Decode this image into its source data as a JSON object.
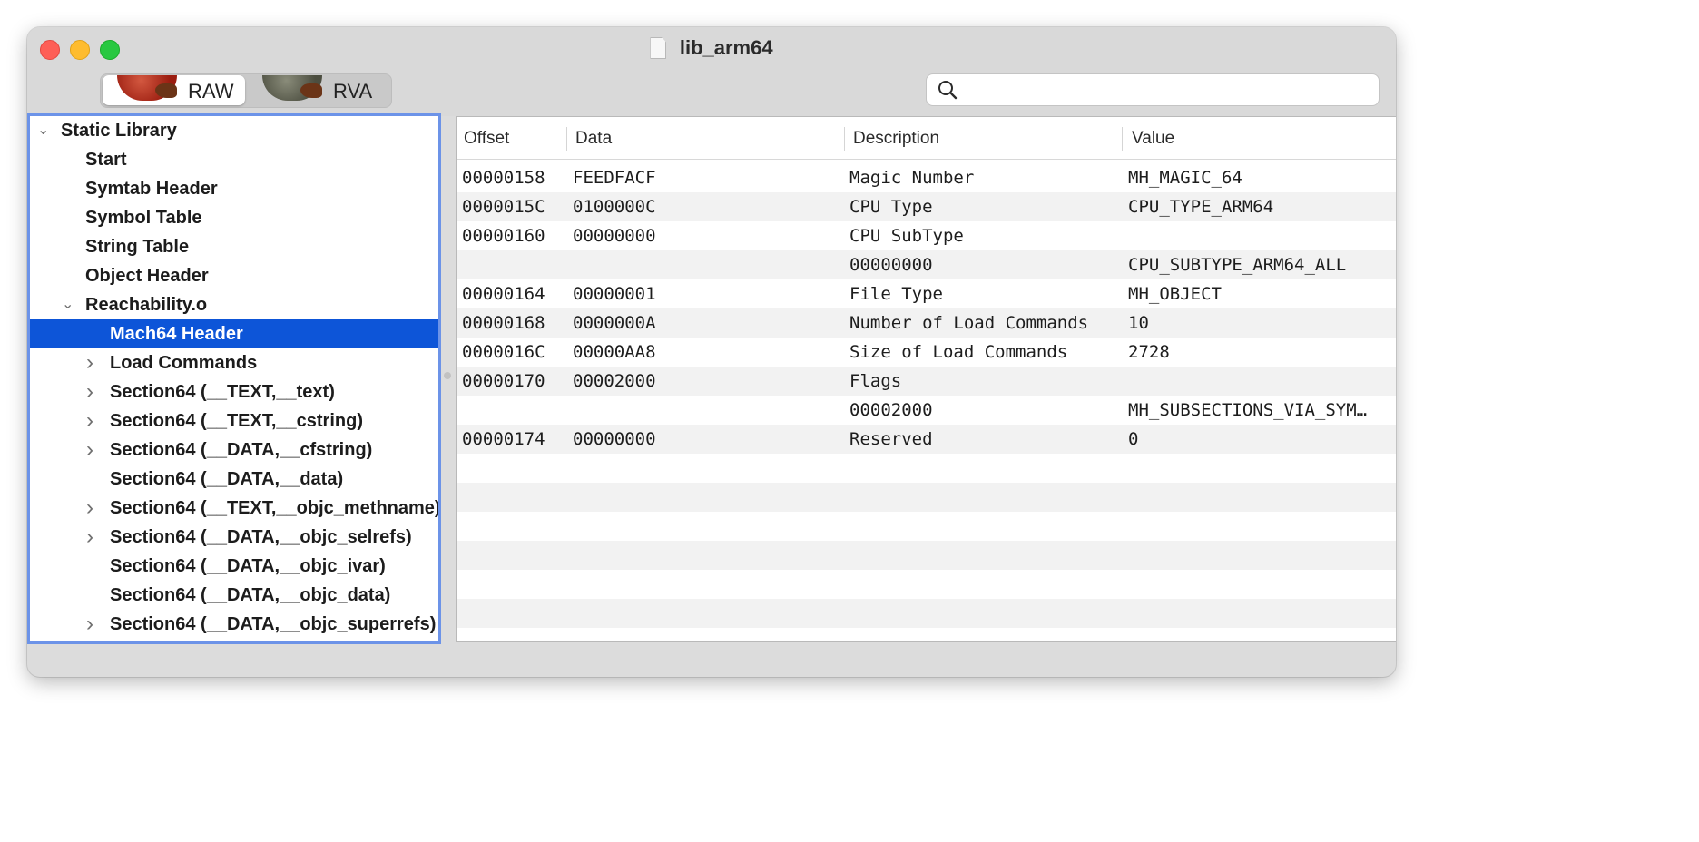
{
  "window": {
    "title": "lib_arm64"
  },
  "toolbar": {
    "modes": [
      {
        "label": "RAW",
        "selected": true
      },
      {
        "label": "RVA",
        "selected": false
      }
    ],
    "search": {
      "value": "",
      "placeholder": ""
    }
  },
  "tree": {
    "items": [
      {
        "label": "Static Library",
        "level": 0,
        "chevron": "down"
      },
      {
        "label": "Start",
        "level": 1,
        "chevron": ""
      },
      {
        "label": "Symtab Header",
        "level": 1,
        "chevron": ""
      },
      {
        "label": "Symbol Table",
        "level": 1,
        "chevron": ""
      },
      {
        "label": "String Table",
        "level": 1,
        "chevron": ""
      },
      {
        "label": "Object Header",
        "level": 1,
        "chevron": ""
      },
      {
        "label": "Reachability.o",
        "level": 1,
        "chevron": "down"
      },
      {
        "label": "Mach64 Header",
        "level": 2,
        "chevron": "",
        "selected": true
      },
      {
        "label": "Load Commands",
        "level": 2,
        "chevron": "right"
      },
      {
        "label": "Section64 (__TEXT,__text)",
        "level": 2,
        "chevron": "right"
      },
      {
        "label": "Section64 (__TEXT,__cstring)",
        "level": 2,
        "chevron": "right"
      },
      {
        "label": "Section64 (__DATA,__cfstring)",
        "level": 2,
        "chevron": "right"
      },
      {
        "label": "Section64 (__DATA,__data)",
        "level": 2,
        "chevron": ""
      },
      {
        "label": "Section64 (__TEXT,__objc_methname)",
        "level": 2,
        "chevron": "right"
      },
      {
        "label": "Section64 (__DATA,__objc_selrefs)",
        "level": 2,
        "chevron": "right"
      },
      {
        "label": "Section64 (__DATA,__objc_ivar)",
        "level": 2,
        "chevron": ""
      },
      {
        "label": "Section64 (__DATA,__objc_data)",
        "level": 2,
        "chevron": ""
      },
      {
        "label": "Section64 (__DATA,__objc_superrefs)",
        "level": 2,
        "chevron": "right"
      }
    ]
  },
  "table": {
    "columns": [
      "Offset",
      "Data",
      "Description",
      "Value"
    ],
    "rows": [
      [
        "00000158",
        "FEEDFACF",
        "Magic Number",
        "MH_MAGIC_64"
      ],
      [
        "0000015C",
        "0100000C",
        "CPU Type",
        "CPU_TYPE_ARM64"
      ],
      [
        "00000160",
        "00000000",
        "CPU SubType",
        ""
      ],
      [
        "",
        "",
        "00000000",
        "CPU_SUBTYPE_ARM64_ALL"
      ],
      [
        "00000164",
        "00000001",
        "File Type",
        "MH_OBJECT"
      ],
      [
        "00000168",
        "0000000A",
        "Number of Load Commands",
        "10"
      ],
      [
        "0000016C",
        "00000AA8",
        "Size of Load Commands",
        "2728"
      ],
      [
        "00000170",
        "00002000",
        "Flags",
        ""
      ],
      [
        "",
        "",
        "00002000",
        "MH_SUBSECTIONS_VIA_SYM…"
      ],
      [
        "00000174",
        "00000000",
        "Reserved",
        "0"
      ]
    ]
  },
  "colors": {
    "selection": "#0d55d8",
    "focus_ring": "#6c93e8",
    "stripe": "#f2f2f2"
  }
}
